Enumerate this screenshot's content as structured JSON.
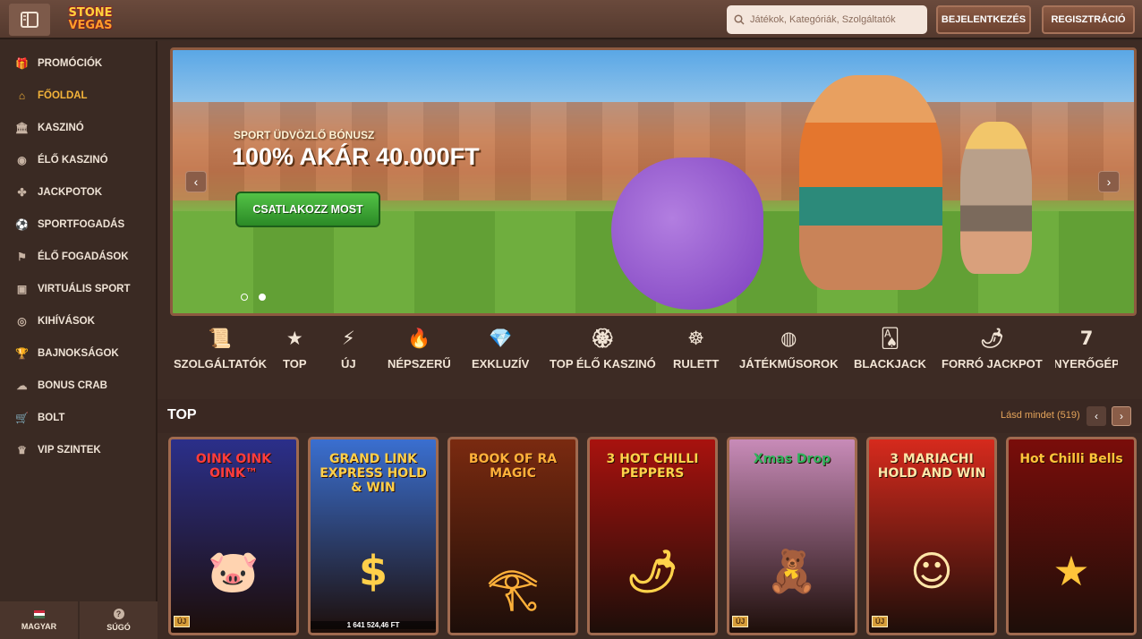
{
  "header": {
    "logo_line1": "STONE",
    "logo_line2": "VEGAS",
    "search_placeholder": "Játékok, Kategóriák, Szolgáltatók",
    "login_label": "BEJELENTKEZÉS",
    "register_label": "REGISZTRÁCIÓ"
  },
  "sidebar": {
    "items": [
      {
        "label": "PROMÓCIÓK",
        "icon": "gift-icon",
        "glyph": "🎁"
      },
      {
        "label": "FŐOLDAL",
        "icon": "home-icon",
        "glyph": "⌂",
        "active": true
      },
      {
        "label": "KASZINÓ",
        "icon": "casino-icon",
        "glyph": "🏛"
      },
      {
        "label": "ÉLŐ KASZINÓ",
        "icon": "chip-icon",
        "glyph": "◉"
      },
      {
        "label": "JACKPOTOK",
        "icon": "clover-icon",
        "glyph": "✤"
      },
      {
        "label": "SPORTFOGADÁS",
        "icon": "ball-icon",
        "glyph": "⚽"
      },
      {
        "label": "ÉLŐ FOGADÁSOK",
        "icon": "live-bet-icon",
        "glyph": "⚑"
      },
      {
        "label": "VIRTUÁLIS SPORT",
        "icon": "virtual-sport-icon",
        "glyph": "▣"
      },
      {
        "label": "KIHÍVÁSOK",
        "icon": "target-icon",
        "glyph": "◎"
      },
      {
        "label": "BAJNOKSÁGOK",
        "icon": "trophy-icon",
        "glyph": "🏆"
      },
      {
        "label": "BONUS CRAB",
        "icon": "crab-icon",
        "glyph": "☁"
      },
      {
        "label": "BOLT",
        "icon": "shop-icon",
        "glyph": "🛒"
      },
      {
        "label": "VIP SZINTEK",
        "icon": "crown-icon",
        "glyph": "♛"
      }
    ],
    "language_label": "MAGYAR",
    "help_label": "SÚGÓ"
  },
  "banner": {
    "subtitle": "SPORT ÜDVÖZLŐ BÓNUSZ",
    "title": "100% AKÁR 40.000FT",
    "cta_label": "CSATLAKOZZ MOST",
    "slide_count": 2,
    "active_slide": 2
  },
  "categories": [
    {
      "label": "SZOLGÁLTATÓK",
      "icon": "scroll-icon",
      "glyph": "📜"
    },
    {
      "label": "TOP",
      "icon": "star-icon",
      "glyph": "★"
    },
    {
      "label": "ÚJ",
      "icon": "lightning-icon",
      "glyph": "⚡"
    },
    {
      "label": "NÉPSZERŰ",
      "icon": "fire-icon",
      "glyph": "🔥"
    },
    {
      "label": "EXKLUZÍV",
      "icon": "diamond-icon",
      "glyph": "💎"
    },
    {
      "label": "TOP ÉLŐ KASZINÓ",
      "icon": "medal-icon",
      "glyph": "🏵"
    },
    {
      "label": "RULETT",
      "icon": "roulette-icon",
      "glyph": "☸"
    },
    {
      "label": "JÁTÉKMŰSOROK",
      "icon": "wheel-icon",
      "glyph": "◍"
    },
    {
      "label": "BLACKJACK",
      "icon": "cards-icon",
      "glyph": "🂡"
    },
    {
      "label": "FORRÓ JACKPOT",
      "icon": "chili-icon",
      "glyph": "🌶"
    },
    {
      "label": "NYERŐGÉP",
      "icon": "slot-icon",
      "glyph": "7"
    }
  ],
  "top_section": {
    "title": "TOP",
    "see_all_label": "Lásd mindet (519)"
  },
  "games": [
    {
      "title": "OINK OINK OINK™",
      "bg": "#2b2f8a",
      "accent": "#ff3d3d",
      "symbol": "🐷",
      "badge": "ÚJ"
    },
    {
      "title": "GRAND LINK EXPRESS HOLD & WIN",
      "bg": "#3a6fd0",
      "accent": "#ffd04a",
      "symbol": "$",
      "footer": "1 641 524,46 FT"
    },
    {
      "title": "BOOK OF RA MAGIC",
      "bg": "#7a2a10",
      "accent": "#ffb13a",
      "symbol": "𓂀"
    },
    {
      "title": "3 HOT CHILLI PEPPERS",
      "bg": "#a8120e",
      "accent": "#ffd24a",
      "symbol": "🌶"
    },
    {
      "title": "Xmas Drop",
      "bg": "#c88bb8",
      "accent": "#2fb35c",
      "symbol": "🧸",
      "badge": "ÚJ"
    },
    {
      "title": "3 MARIACHI HOLD AND WIN",
      "bg": "#d62a1d",
      "accent": "#ffe6a8",
      "symbol": "☺",
      "badge": "ÚJ"
    },
    {
      "title": "Hot Chilli Bells",
      "bg": "#7a0d0a",
      "accent": "#ffc43a",
      "symbol": "★"
    }
  ]
}
